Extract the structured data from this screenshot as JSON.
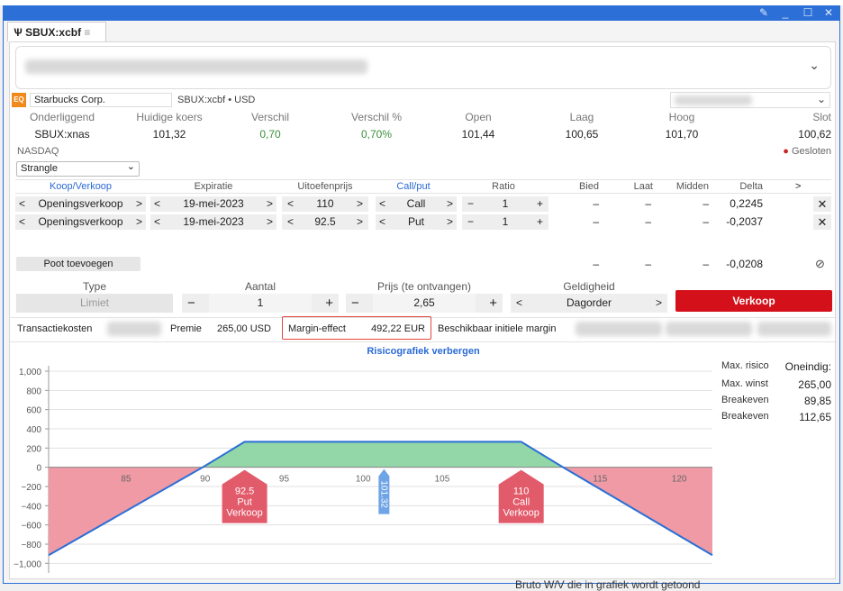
{
  "window": {
    "tab_title": "SBUX:xcbf",
    "tab_menu_icon": "hamburger-icon",
    "minimize": "_",
    "maximize": "☐",
    "close": "✕",
    "pin": "📌"
  },
  "instrument": {
    "name": "Starbucks Corp.",
    "symbol_line": "SBUX:xcbf • USD",
    "exchange": "NASDAQ",
    "status": "Gesloten",
    "status_color": "#cc2222"
  },
  "quote": {
    "headers": [
      "Onderliggend",
      "Huidige koers",
      "Verschil",
      "Verschil %",
      "Open",
      "Laag",
      "Hoog",
      "Slot"
    ],
    "values": [
      "SBUX:xnas",
      "101,32",
      "0,70",
      "0,70%",
      "101,44",
      "100,65",
      "101,70",
      "100,62"
    ]
  },
  "strategy": {
    "selected": "Strangle"
  },
  "legs": {
    "headers": [
      "Koop/Verkoop",
      "Expiratie",
      "Uitoefenprijs",
      "Call/put",
      "Ratio",
      "Bied",
      "Laat",
      "Midden",
      "Delta"
    ],
    "rows": [
      {
        "side": "Openingsverkoop",
        "expiry": "19-mei-2023",
        "strike": "110",
        "type": "Call",
        "ratio": "1",
        "bid": "–",
        "ask": "–",
        "mid": "–",
        "delta": "0,2245"
      },
      {
        "side": "Openingsverkoop",
        "expiry": "19-mei-2023",
        "strike": "92.5",
        "type": "Put",
        "ratio": "1",
        "bid": "–",
        "ask": "–",
        "mid": "–",
        "delta": "-0,2037"
      }
    ],
    "total": {
      "bid": "–",
      "ask": "–",
      "mid": "–",
      "delta": "-0,0208"
    },
    "add_leg": "Poot toevoegen"
  },
  "order": {
    "type_label": "Type",
    "type_value": "Limiet",
    "qty_label": "Aantal",
    "qty_value": "1",
    "price_label": "Prijs (te ontvangen)",
    "price_value": "2,65",
    "validity_label": "Geldigheid",
    "validity_value": "Dagorder",
    "submit": "Verkoop"
  },
  "costs": {
    "transaction_costs": "Transactiekosten",
    "premium_label": "Premie",
    "premium_value": "265,00 USD",
    "margin_label": "Margin-effect",
    "margin_value": "492,22 EUR",
    "avail_margin": "Beschikbaar initiele margin"
  },
  "risk": {
    "toggle": "Risicografiek verbergen",
    "stats": [
      {
        "label": "Max. risico",
        "value": "Oneindig:"
      },
      {
        "label": "Max. winst",
        "value": "265,00"
      },
      {
        "label": "Breakeven",
        "value": "89,85"
      },
      {
        "label": "Breakeven",
        "value": "112,65"
      }
    ],
    "footer": "Bruto W/V die in grafiek wordt getoond",
    "markers": [
      {
        "strike": 92.5,
        "lines": [
          "92.5",
          "Put",
          "Verkoop"
        ]
      },
      {
        "strike": 110,
        "lines": [
          "110",
          "Call",
          "Verkoop"
        ]
      }
    ],
    "current_price": {
      "value": 101.32,
      "label": "101.32"
    }
  },
  "chart_data": {
    "type": "line",
    "x": [
      80.1,
      89.85,
      92.5,
      110,
      112.65,
      122.1
    ],
    "y": [
      -915,
      0,
      265,
      265,
      0,
      -915
    ],
    "xlim": [
      80.1,
      122.1
    ],
    "ylim": [
      -1100,
      1150
    ],
    "xticks": [
      85,
      90,
      95,
      100,
      105,
      110,
      115,
      120
    ],
    "yticks": [
      1000,
      800,
      600,
      400,
      200,
      0,
      -200,
      -400,
      -600,
      -800,
      -1000
    ],
    "ytick_labels": [
      "1,000",
      "800",
      "600",
      "400",
      "200",
      "0",
      "−200",
      "−400",
      "−600",
      "−800",
      "−1,000"
    ],
    "profit_color": "#93d6a8",
    "loss_color": "#ef9aa5",
    "line_color": "#2b6fd6",
    "marker_color": "#e25b6b",
    "price_color": "#6fa4e6"
  }
}
